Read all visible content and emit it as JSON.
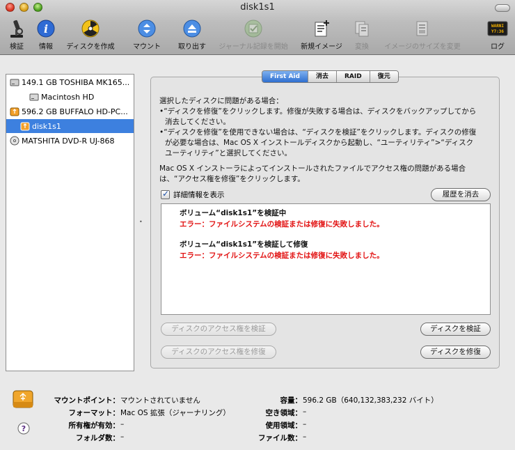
{
  "window": {
    "title": "disk1s1"
  },
  "toolbar": {
    "items": [
      {
        "label": "検証",
        "icon": "microscope-icon",
        "enabled": true
      },
      {
        "label": "情報",
        "icon": "info-icon",
        "enabled": true
      },
      {
        "label": "ディスクを作成",
        "icon": "burn-icon",
        "enabled": true
      },
      {
        "label": "マウント",
        "icon": "mount-icon",
        "enabled": true
      },
      {
        "label": "取り出す",
        "icon": "eject-icon",
        "enabled": true
      },
      {
        "label": "ジャーナル記録を開始",
        "icon": "journal-icon",
        "enabled": false
      },
      {
        "label": "新規イメージ",
        "icon": "new-image-icon",
        "enabled": true
      },
      {
        "label": "変換",
        "icon": "convert-icon",
        "enabled": false
      },
      {
        "label": "イメージのサイズを変更",
        "icon": "resize-image-icon",
        "enabled": false
      },
      {
        "label": "ログ",
        "icon": "log-icon",
        "enabled": true
      }
    ]
  },
  "sidebar": {
    "items": [
      {
        "label": "149.1 GB TOSHIBA MK165...",
        "type": "disk",
        "selected": false
      },
      {
        "label": "Macintosh HD",
        "type": "volume",
        "selected": false
      },
      {
        "label": "596.2 GB BUFFALO HD-PC...",
        "type": "disk",
        "selected": false
      },
      {
        "label": "disk1s1",
        "type": "volume",
        "selected": true
      },
      {
        "label": "MATSHITA DVD-R UJ-868",
        "type": "optical",
        "selected": false
      }
    ]
  },
  "tabs": [
    {
      "label": "First Aid",
      "active": true
    },
    {
      "label": "消去",
      "active": false
    },
    {
      "label": "RAID",
      "active": false
    },
    {
      "label": "復元",
      "active": false
    }
  ],
  "first_aid": {
    "instructions": [
      "選択したディスクに問題がある場合：",
      "•“ディスクを修復”をクリックします。修復が失敗する場合は、ディスクをバックアップしてから",
      "  消去してください。",
      "•“ディスクを修復”を使用できない場合は、“ディスクを検証”をクリックします。ディスクの修復",
      "  が必要な場合は、Mac OS X インストールディスクから起動し、“ユーティリティ”>“ディスク",
      "  ユーティリティ”と選択してください。"
    ],
    "permissions_note": [
      "Mac OS X インストーラによってインストールされたファイルでアクセス権の問題がある場合",
      "は、“アクセス権を修復”をクリックします。"
    ],
    "show_details_label": "詳細情報を表示",
    "show_details_checked": true,
    "clear_history_label": "履歴を消去",
    "log": [
      {
        "kind": "head",
        "text": "ボリューム“disk1s1”を検証中"
      },
      {
        "kind": "err",
        "text": "エラー：ファイルシステムの検証または修復に失敗しました。"
      },
      {
        "kind": "head",
        "text": "ボリューム“disk1s1”を検証して修復"
      },
      {
        "kind": "err",
        "text": "エラー：ファイルシステムの検証または修復に失敗しました。"
      }
    ],
    "verify_permissions_label": "ディスクのアクセス権を検証",
    "repair_permissions_label": "ディスクのアクセス権を修復",
    "verify_disk_label": "ディスクを検証",
    "repair_disk_label": "ディスクを修復"
  },
  "info": {
    "mount_point_label": "マウントポイント：",
    "mount_point_value": "マウントされていません",
    "format_label": "フォーマット：",
    "format_value": "Mac OS 拡張（ジャーナリング）",
    "owners_label": "所有権が有効：",
    "owners_value": "–",
    "folders_label": "フォルダ数：",
    "folders_value": "–",
    "capacity_label": "容量：",
    "capacity_value": "596.2 GB（640,132,383,232 バイト）",
    "available_label": "空き領域：",
    "available_value": "–",
    "used_label": "使用領域：",
    "used_value": "–",
    "files_label": "ファイル数：",
    "files_value": "–"
  }
}
